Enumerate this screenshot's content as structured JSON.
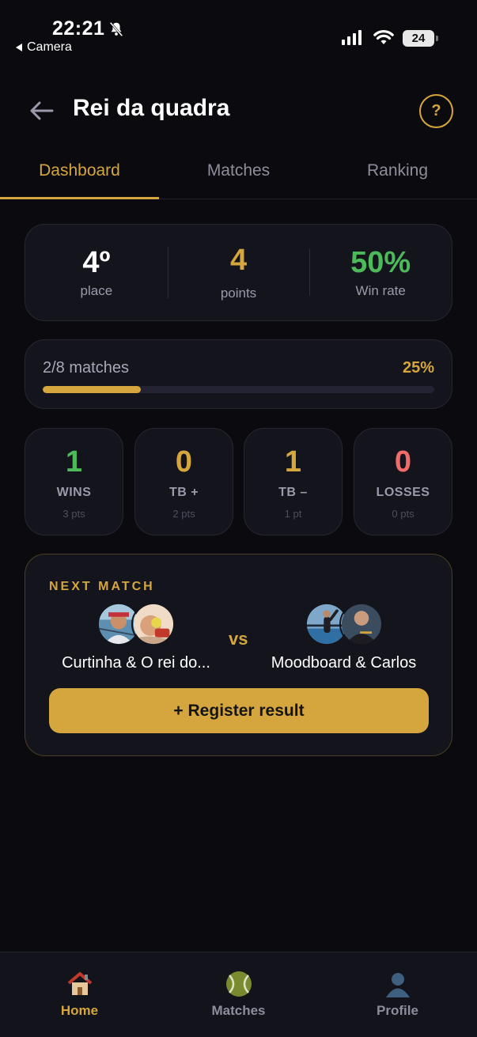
{
  "status_bar": {
    "time": "22:21",
    "back_app": "Camera",
    "battery": "24"
  },
  "header": {
    "title": "Rei da quadra",
    "help": "?"
  },
  "tabs": [
    {
      "label": "Dashboard",
      "active": true
    },
    {
      "label": "Matches",
      "active": false
    },
    {
      "label": "Ranking",
      "active": false
    }
  ],
  "summary": {
    "place_value": "4º",
    "place_label": "place",
    "points_value": "4",
    "points_label": "points",
    "winrate_value": "50%",
    "winrate_label": "Win rate"
  },
  "progress": {
    "label": "2/8 matches",
    "percent_text": "25%",
    "fraction": 0.25
  },
  "stats": [
    {
      "value": "1",
      "label": "WINS",
      "points": "3 pts",
      "color": "#4cb95a"
    },
    {
      "value": "0",
      "label": "TB +",
      "points": "2 pts",
      "color": "#d6a63e"
    },
    {
      "value": "1",
      "label": "TB –",
      "points": "1 pt",
      "color": "#d6a63e"
    },
    {
      "value": "0",
      "label": "LOSSES",
      "points": "0 pts",
      "color": "#f26a6a"
    }
  ],
  "next_match": {
    "heading": "NEXT MATCH",
    "team_left": "Curtinha & O rei do...",
    "vs": "vs",
    "team_right": "Moodboard & Carlos",
    "register_button": "+ Register result"
  },
  "bottom_nav": [
    {
      "label": "Home",
      "icon": "house-icon",
      "active": true
    },
    {
      "label": "Matches",
      "icon": "tennis-ball-icon",
      "active": false
    },
    {
      "label": "Profile",
      "icon": "person-icon",
      "active": false
    }
  ],
  "colors": {
    "accent": "#d6a63e",
    "win": "#4cb95a",
    "loss": "#f26a6a",
    "background": "#0b0b0f",
    "card": "#14141c"
  }
}
